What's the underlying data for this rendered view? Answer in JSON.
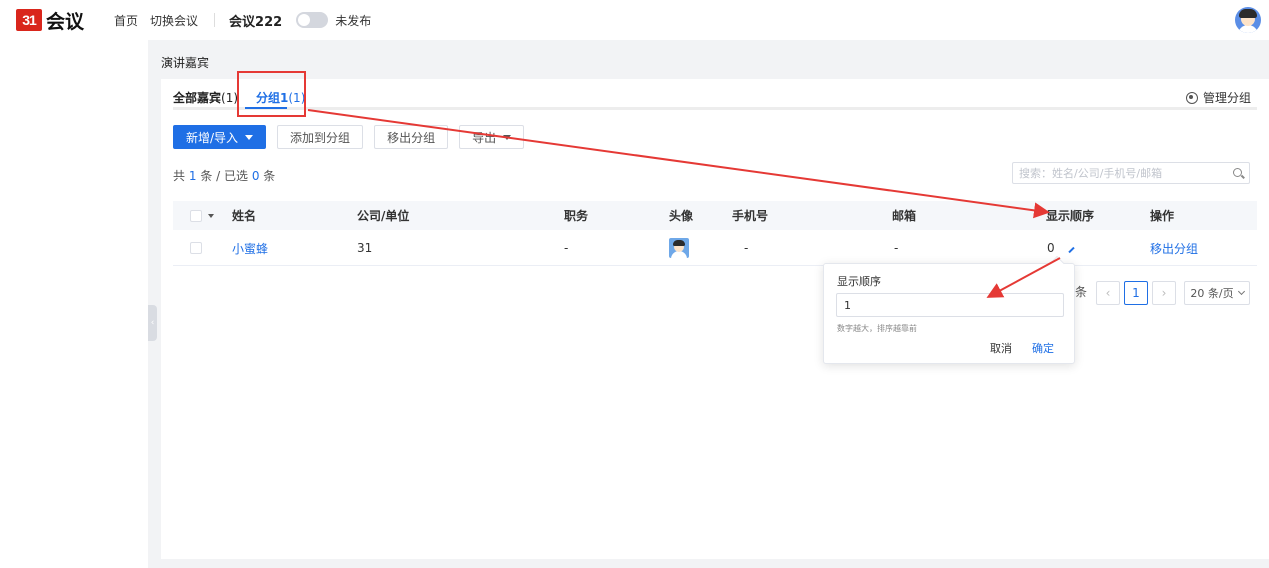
{
  "header": {
    "logo_mark": "31",
    "logo_text": "会议",
    "nav": [
      "首页",
      "切换会议"
    ],
    "conference_name": "会议222",
    "publish_status": "未发布"
  },
  "breadcrumb": "演讲嘉宾",
  "tabs": {
    "all_label": "全部嘉宾",
    "all_count": "(1)",
    "group_label": "分组1",
    "group_count": "(1)"
  },
  "manage_groups": "管理分组",
  "toolbar": {
    "new_import": "新增/导入",
    "add_to_group": "添加到分组",
    "remove_from_group": "移出分组",
    "export": "导出"
  },
  "summary": {
    "prefix": "共",
    "total": "1",
    "mid": "条 / 已选",
    "selected": "0",
    "suffix": "条"
  },
  "search": {
    "placeholder": "搜索：姓名/公司/手机号/邮箱"
  },
  "table": {
    "columns": [
      "姓名",
      "公司/单位",
      "职务",
      "头像",
      "手机号",
      "邮箱",
      "显示顺序",
      "操作"
    ],
    "rows": [
      {
        "name": "小蜜蜂",
        "company": "31",
        "title": "-",
        "phone": "-",
        "email": "-",
        "order": "0",
        "action": "移出分组"
      }
    ]
  },
  "pagination": {
    "total_suffix": "条",
    "prev": "‹",
    "current_page": "1",
    "next": "›",
    "page_size": "20 条/页"
  },
  "popover": {
    "title": "显示顺序",
    "value": "1",
    "hint": "数字越大，排序越靠前",
    "cancel": "取消",
    "confirm": "确定"
  },
  "colors": {
    "primary": "#1f6fe5",
    "annotation": "#e53935"
  }
}
